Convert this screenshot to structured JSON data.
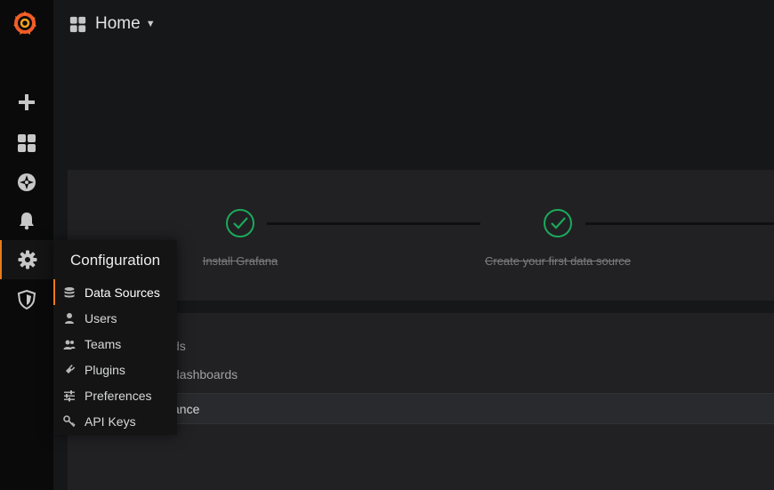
{
  "navbar": {
    "title": "Home",
    "title_icon": "dashboard-grid-icon"
  },
  "sidebar": {
    "items": [
      {
        "icon": "plus-icon",
        "active": false
      },
      {
        "icon": "dashboards-icon",
        "active": false
      },
      {
        "icon": "explore-compass-icon",
        "active": false
      },
      {
        "icon": "bell-icon",
        "active": false
      },
      {
        "icon": "gear-icon",
        "active": true
      },
      {
        "icon": "shield-icon",
        "active": false
      }
    ]
  },
  "config_menu": {
    "header": "Configuration",
    "items": [
      {
        "label": "Data Sources",
        "icon": "database-icon",
        "active": true
      },
      {
        "label": "Users",
        "icon": "user-icon",
        "active": false
      },
      {
        "label": "Teams",
        "icon": "users-icon",
        "active": false
      },
      {
        "label": "Plugins",
        "icon": "plug-icon",
        "active": false
      },
      {
        "label": "Preferences",
        "icon": "sliders-icon",
        "active": false
      },
      {
        "label": "API Keys",
        "icon": "key-icon",
        "active": false
      }
    ]
  },
  "getting_started": {
    "steps": [
      {
        "label": "Install Grafana",
        "done": true
      },
      {
        "label": "Create your first data source",
        "done": true
      }
    ]
  },
  "dashboards_panel": {
    "row1": "ds",
    "row2": "dashboards",
    "row3": "ance"
  },
  "colors": {
    "accent": "#eb7b18",
    "success": "#1ba95a",
    "sidebar_bg": "#0a0a0b",
    "panel_bg": "#212124"
  }
}
